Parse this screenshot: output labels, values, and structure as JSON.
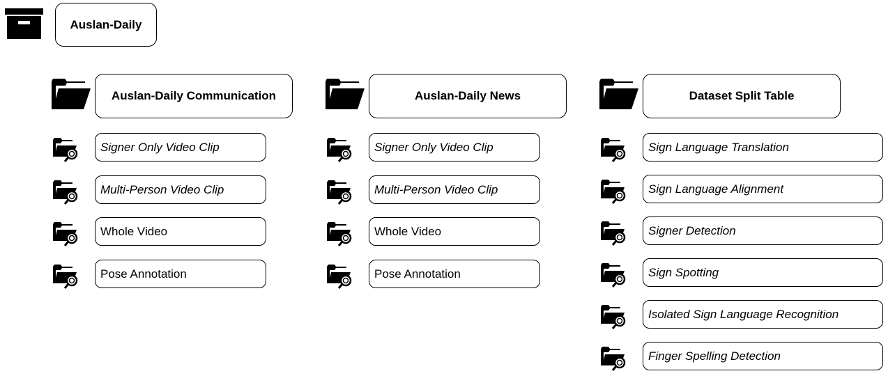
{
  "root": {
    "label": "Auslan-Daily",
    "icon": "archive-box-icon"
  },
  "columns": [
    {
      "title": "Auslan-Daily Communication",
      "items": [
        {
          "label": "Signer Only Video Clip",
          "italic": true
        },
        {
          "label": "Multi-Person Video Clip",
          "italic": true
        },
        {
          "label": "Whole Video",
          "italic": false
        },
        {
          "label": "Pose Annotation",
          "italic": false
        }
      ]
    },
    {
      "title": "Auslan-Daily News",
      "items": [
        {
          "label": "Signer Only Video Clip",
          "italic": true
        },
        {
          "label": "Multi-Person Video Clip",
          "italic": true
        },
        {
          "label": "Whole Video",
          "italic": false
        },
        {
          "label": "Pose Annotation",
          "italic": false
        }
      ]
    },
    {
      "title": "Dataset Split Table",
      "items": [
        {
          "label": "Sign Language Translation",
          "italic": true
        },
        {
          "label": "Sign Language Alignment",
          "italic": true
        },
        {
          "label": "Signer Detection",
          "italic": true
        },
        {
          "label": "Sign Spotting",
          "italic": true
        },
        {
          "label": "Isolated Sign Language Recognition",
          "italic": true
        },
        {
          "label": "Finger Spelling Detection",
          "italic": true
        }
      ]
    }
  ],
  "icons": {
    "folder": "folder-open-icon",
    "folder_search": "folder-search-icon"
  }
}
